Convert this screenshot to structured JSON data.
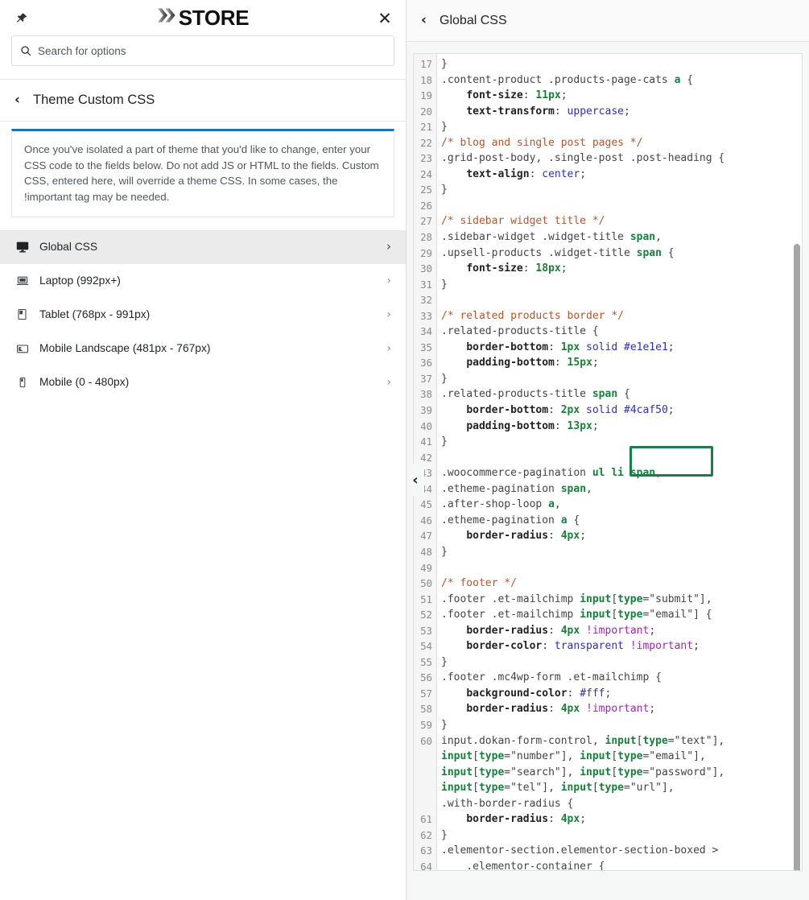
{
  "brand": {
    "logo_x": "X",
    "logo_text": "STORE"
  },
  "panel": {
    "pin_icon": "pin-icon",
    "close_icon": "close-icon",
    "search_placeholder": "Search for options",
    "search_value": "",
    "search_icon": "search-icon",
    "section_title": "Theme Custom CSS",
    "back_chevron": "‹"
  },
  "notice": {
    "text": "Once you've isolated a part of theme that you'd like to change, enter your CSS code to the fields below. Do not add JS or HTML to the fields. Custom CSS, entered here, will override a theme CSS. In some cases, the !important tag may be needed.",
    "accent_color": "#2271b1"
  },
  "menu": {
    "items": [
      {
        "label": "Global CSS",
        "icon": "desktop-monitor-icon",
        "arrow": "›",
        "active": true
      },
      {
        "label": "Laptop (992px+)",
        "icon": "laptop-icon",
        "arrow": "›",
        "active": false
      },
      {
        "label": "Tablet (768px - 991px)",
        "icon": "tablet-icon",
        "arrow": "›",
        "active": false
      },
      {
        "label": "Mobile Landscape (481px - 767px)",
        "icon": "mobile-landscape-icon",
        "arrow": "›",
        "active": false
      },
      {
        "label": "Mobile (0 - 480px)",
        "icon": "mobile-icon",
        "arrow": "›",
        "active": false
      }
    ]
  },
  "editor": {
    "header_title": "Global CSS",
    "back_chevron": "‹",
    "collapse_chevron": "‹",
    "highlight_color": "#17804a",
    "highlighted_value": "#4caf50",
    "first_line_number": 17,
    "last_line_number": 64,
    "line_numbers": [
      17,
      18,
      19,
      20,
      21,
      22,
      23,
      24,
      25,
      26,
      27,
      28,
      29,
      30,
      31,
      32,
      33,
      34,
      35,
      36,
      37,
      38,
      39,
      40,
      41,
      42,
      43,
      44,
      45,
      46,
      47,
      48,
      49,
      50,
      51,
      52,
      53,
      54,
      55,
      56,
      57,
      58,
      59,
      60,
      "",
      "",
      "",
      "",
      61,
      62,
      63,
      64,
      ""
    ],
    "lines": [
      "}",
      ".content-product .products-page-cats a {",
      "    font-size: 11px;",
      "    text-transform: uppercase;",
      "}",
      "/* blog and single post pages */",
      ".grid-post-body, .single-post .post-heading {",
      "    text-align: center;",
      "}",
      "",
      "/* sidebar widget title */",
      ".sidebar-widget .widget-title span,",
      ".upsell-products .widget-title span {",
      "    font-size: 18px;",
      "}",
      "",
      "/* related products border */",
      ".related-products-title {",
      "    border-bottom: 1px solid #e1e1e1;",
      "    padding-bottom: 15px;",
      "}",
      ".related-products-title span {",
      "    border-bottom: 2px solid #4caf50;",
      "    padding-bottom: 13px;",
      "}",
      "",
      ".woocommerce-pagination ul li span,",
      ".etheme-pagination span,",
      ".after-shop-loop a,",
      ".etheme-pagination a {",
      "    border-radius: 4px;",
      "}",
      "",
      "/* footer */",
      ".footer .et-mailchimp input[type=\"submit\"],",
      ".footer .et-mailchimp input[type=\"email\"] {",
      "    border-radius: 4px !important;",
      "    border-color: transparent !important;",
      "}",
      ".footer .mc4wp-form .et-mailchimp {",
      "    background-color: #fff;",
      "    border-radius: 4px !important;",
      "}",
      "input.dokan-form-control, input[type=\"text\"],",
      "input[type=\"number\"], input[type=\"email\"],",
      "input[type=\"search\"], input[type=\"password\"],",
      "input[type=\"tel\"], input[type=\"url\"],",
      ".with-border-radius {",
      "    border-radius: 4px;",
      "}",
      ".elementor-section.elementor-section-boxed >",
      "    .elementor-container {"
    ]
  }
}
